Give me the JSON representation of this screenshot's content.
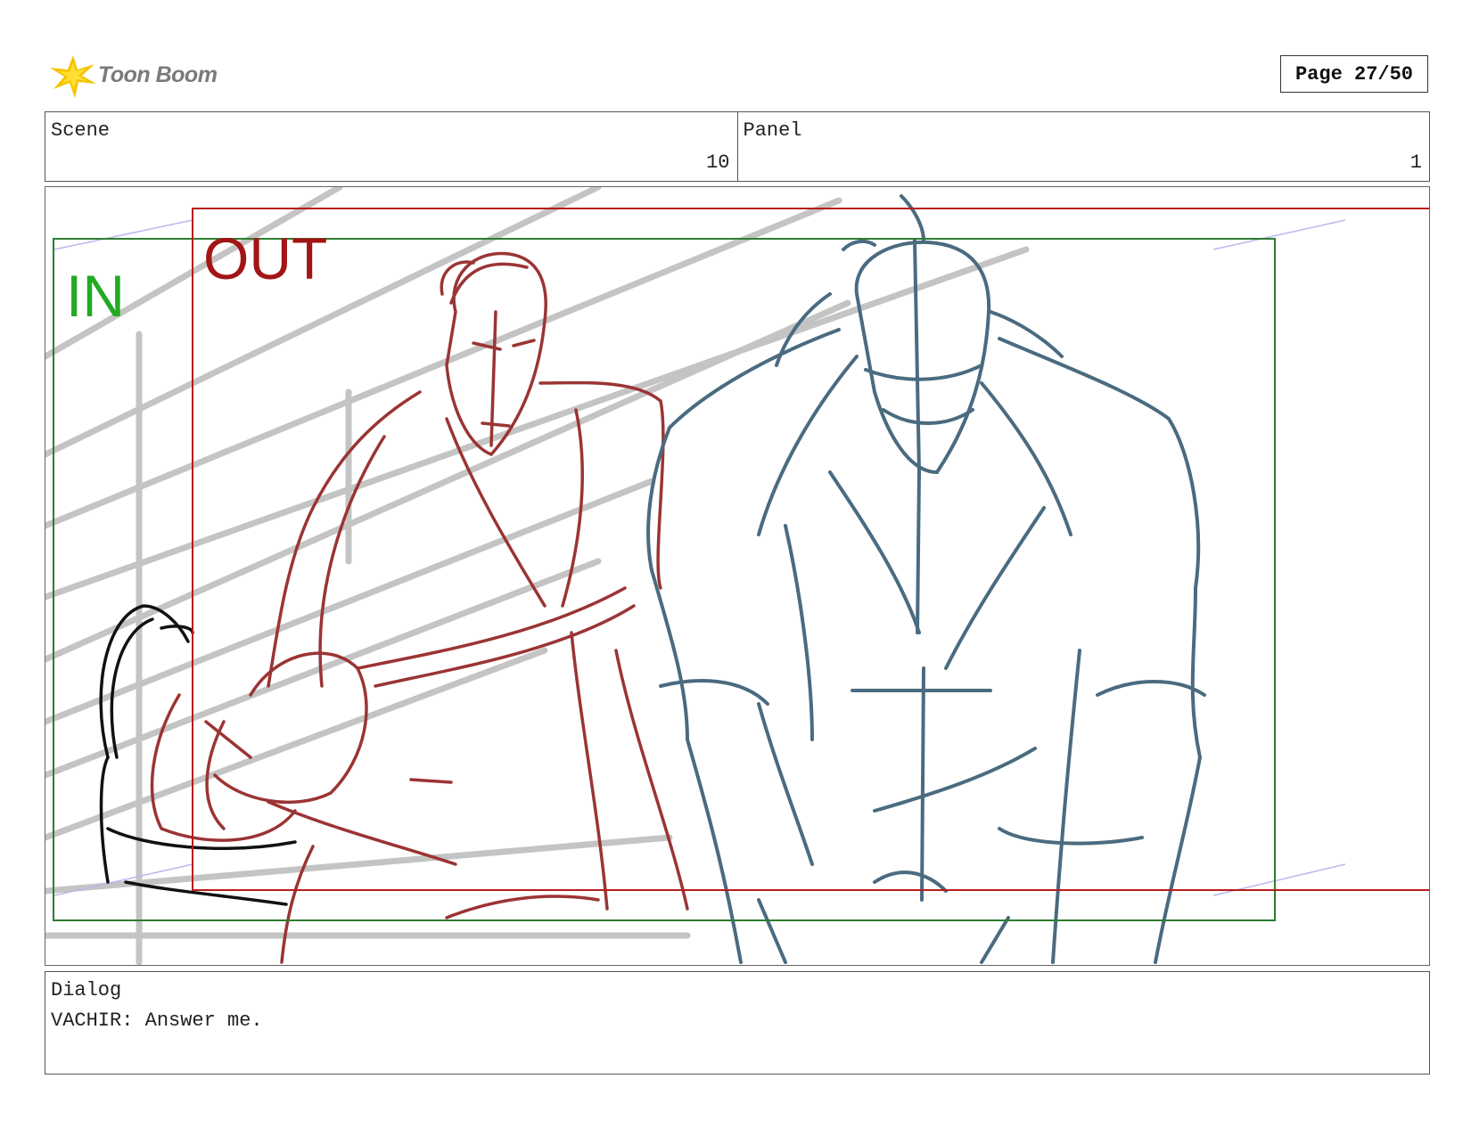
{
  "header": {
    "logo_text": "Toon Boom",
    "page_label": "Page 27/50"
  },
  "info": {
    "scene_label": "Scene",
    "scene_value": "10",
    "panel_label": "Panel",
    "panel_value": "1"
  },
  "panel": {
    "in_label": "IN",
    "out_label": "OUT",
    "colors": {
      "in_frame": "#2e7d32",
      "in_text": "#22aa22",
      "out_frame": "#b71c1c",
      "out_text": "#a31515",
      "character_left": "#9b3434",
      "character_right": "#4a6b80",
      "background_lines": "#c4c4c4",
      "camera_guides": "#b8b8f0"
    }
  },
  "dialog": {
    "label": "Dialog",
    "text": "VACHIR: Answer me."
  }
}
